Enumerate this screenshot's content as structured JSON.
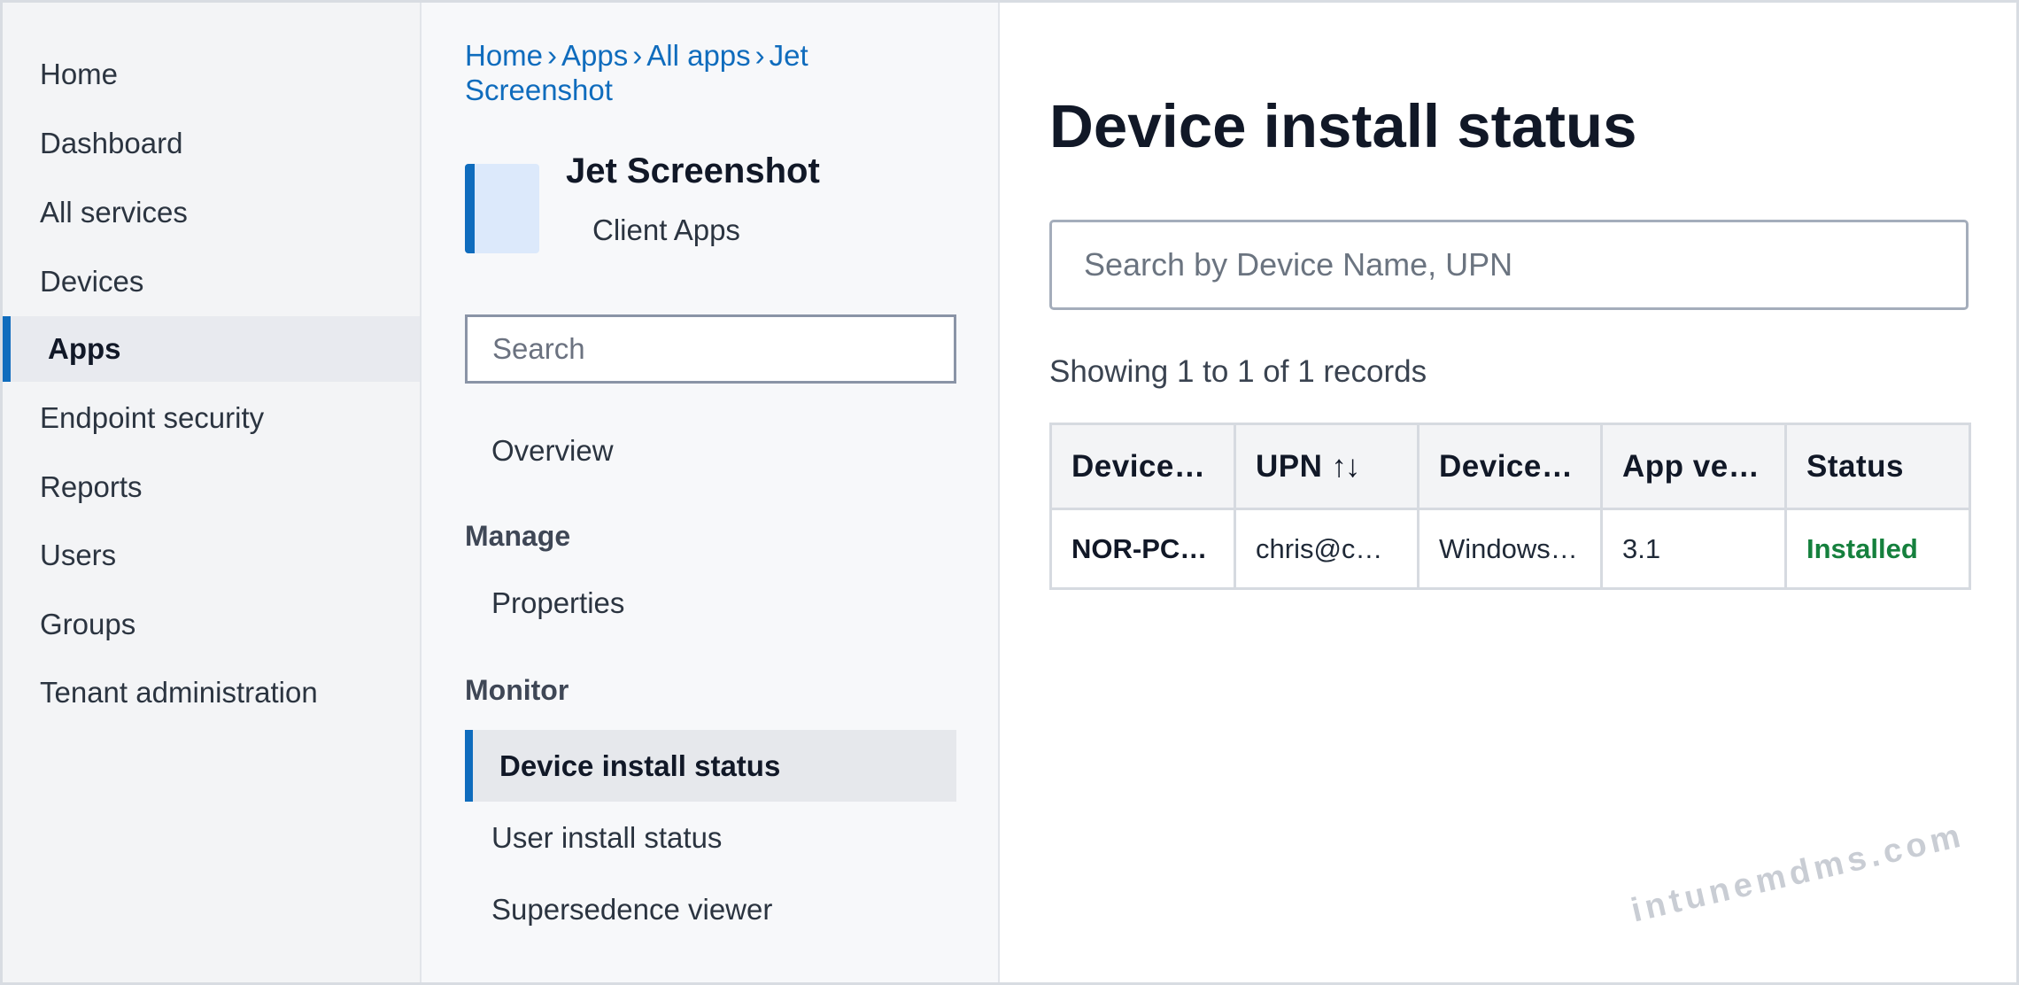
{
  "left_nav": {
    "items": [
      {
        "label": "Home"
      },
      {
        "label": "Dashboard"
      },
      {
        "label": "All services"
      },
      {
        "label": "Devices"
      },
      {
        "label": "Apps"
      },
      {
        "label": "Endpoint security"
      },
      {
        "label": "Reports"
      },
      {
        "label": "Users"
      },
      {
        "label": "Groups"
      },
      {
        "label": "Tenant administration"
      }
    ],
    "active": "Apps"
  },
  "breadcrumb": {
    "items": [
      "Home",
      "Apps",
      "All apps",
      "Jet Screenshot"
    ],
    "separator": "›"
  },
  "app": {
    "name": "Jet Screenshot",
    "subtitle": "Client Apps",
    "tile_color": "#dce9fb",
    "accent": "#0f6cbd"
  },
  "blade": {
    "search_placeholder": "Search",
    "overview": "Overview",
    "manage_heading": "Manage",
    "properties": "Properties",
    "monitor_heading": "Monitor",
    "device_install_status": "Device install status",
    "user_install_status": "User install status",
    "supersedence_viewer": "Supersedence viewer"
  },
  "main": {
    "title": "Device install status",
    "search_placeholder": "Search by Device Name, UPN",
    "records_text": "Showing 1 to 1 of 1 records",
    "table": {
      "headers": [
        "Device…",
        "UPN",
        "Device…",
        "App ve…",
        "Status"
      ],
      "sort_glyph": "↑↓",
      "rows": [
        {
          "device": "NOR-PC…",
          "upn": "chris@c…",
          "platform": "Windows…",
          "version": "3.1",
          "status": "Installed"
        }
      ]
    },
    "status_color": "#15803d"
  },
  "watermark": "intunemdms.com"
}
